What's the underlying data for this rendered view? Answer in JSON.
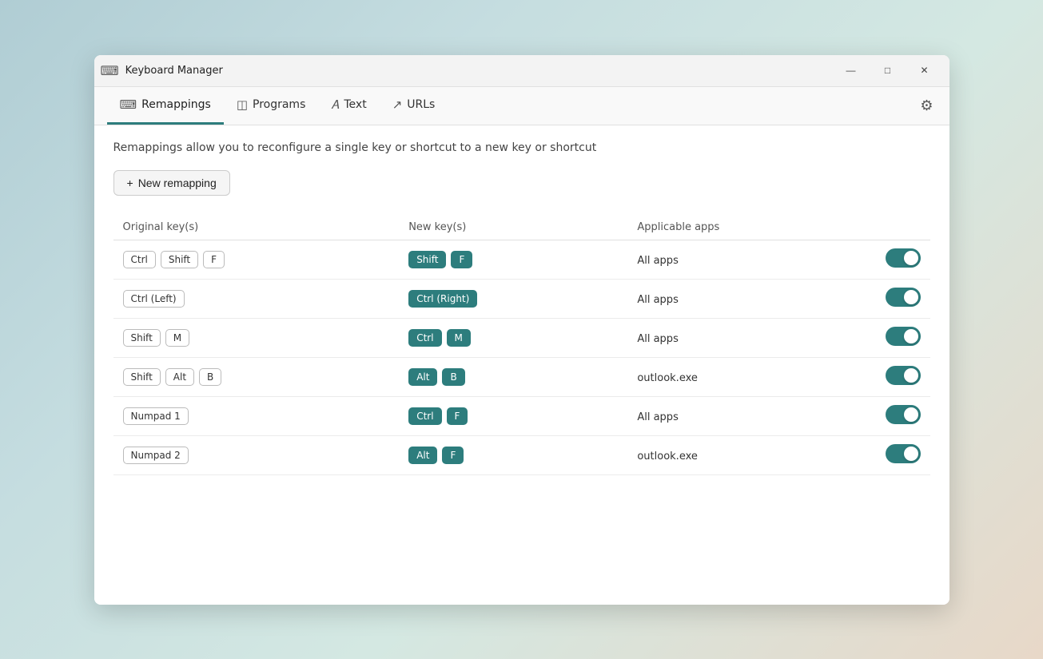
{
  "window": {
    "title": "Keyboard Manager",
    "icon": "⌨"
  },
  "title_bar": {
    "minimize": "—",
    "maximize": "□",
    "close": "✕"
  },
  "tabs": [
    {
      "id": "remappings",
      "label": "Remappings",
      "icon": "⌨",
      "active": true
    },
    {
      "id": "programs",
      "label": "Programs",
      "icon": "◫"
    },
    {
      "id": "text",
      "label": "Text",
      "icon": "A"
    },
    {
      "id": "urls",
      "label": "URLs",
      "icon": "↗"
    }
  ],
  "description": "Remappings allow you to reconfigure a single key or shortcut to a new key or shortcut",
  "new_remap_btn": "+ New remapping",
  "table": {
    "headers": [
      "Original key(s)",
      "New key(s)",
      "Applicable apps",
      ""
    ],
    "rows": [
      {
        "original": [
          "Ctrl",
          "Shift",
          "F"
        ],
        "new_keys": [
          "Shift",
          "F"
        ],
        "app": "All apps",
        "enabled": true
      },
      {
        "original": [
          "Ctrl (Left)"
        ],
        "new_keys": [
          "Ctrl (Right)"
        ],
        "app": "All apps",
        "enabled": true
      },
      {
        "original": [
          "Shift",
          "M"
        ],
        "new_keys": [
          "Ctrl",
          "M"
        ],
        "app": "All apps",
        "enabled": true
      },
      {
        "original": [
          "Shift",
          "Alt",
          "B"
        ],
        "new_keys": [
          "Alt",
          "B"
        ],
        "app": "outlook.exe",
        "enabled": true
      },
      {
        "original": [
          "Numpad 1"
        ],
        "new_keys": [
          "Ctrl",
          "F"
        ],
        "app": "All apps",
        "enabled": true
      },
      {
        "original": [
          "Numpad 2"
        ],
        "new_keys": [
          "Alt",
          "F"
        ],
        "app": "outlook.exe",
        "enabled": true
      }
    ]
  }
}
